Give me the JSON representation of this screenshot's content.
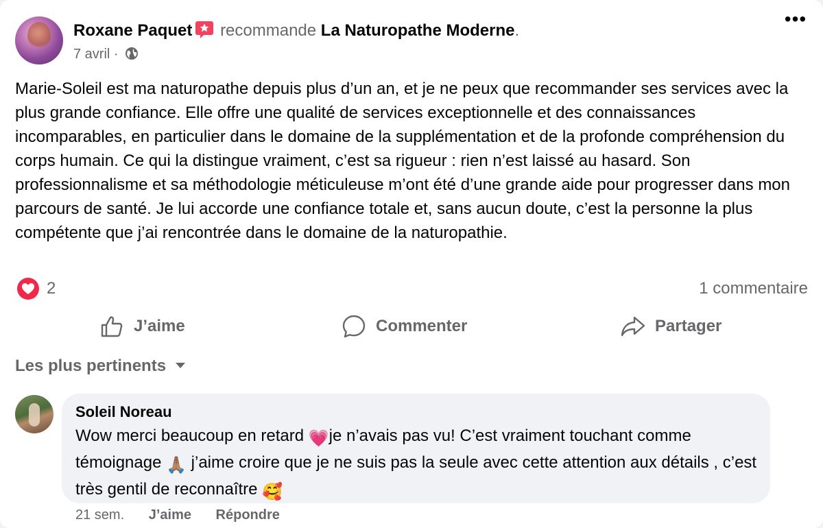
{
  "post": {
    "author": "Roxane Paquet",
    "recommends": "recommande",
    "page": "La Naturopathe Moderne",
    "period": ".",
    "date": "7 avril",
    "separator": "·",
    "more": "•••",
    "body": "Marie-Soleil est ma naturopathe  depuis plus d’un an, et je ne peux que recommander ses services avec la plus grande confiance. Elle offre une qualité de services exceptionnelle et des connaissances incomparables, en particulier dans le domaine de la supplémentation et de la profonde compréhension du corps humain. Ce qui la distingue vraiment, c’est sa rigueur : rien n’est laissé au hasard. Son professionnalisme et sa méthodologie méticuleuse m’ont été d’une grande aide pour progresser dans mon parcours de santé. Je lui accorde une confiance totale et, sans aucun doute, c’est la personne la plus compétente que j’ai rencontrée dans le domaine de la naturopathie."
  },
  "reactions": {
    "count": "2",
    "comments": "1 commentaire"
  },
  "actions": {
    "like": "J’aime",
    "comment": "Commenter",
    "share": "Partager"
  },
  "sort": {
    "label": "Les plus pertinents"
  },
  "comment": {
    "author": "Soleil Noreau",
    "text_1": "Wow merci beaucoup en retard ",
    "emoji_1": "💗",
    "text_2": "je n’avais pas vu! C’est vraiment touchant comme témoignage ",
    "emoji_2": "🙏🏽",
    "text_3": " j’aime croire que je ne suis pas la seule avec cette attention aux détails , c’est très gentil de reconnaître ",
    "emoji_3": "🥰",
    "time": "21 sem.",
    "like": "J’aime",
    "reply": "Répondre"
  },
  "colors": {
    "secondary_text": "#65676b",
    "heart_red": "#f0284a",
    "badge_pink": "#f3425f",
    "bubble_bg": "#f0f2f5"
  },
  "icons": [
    "recommend-badge-icon",
    "globe-icon",
    "more-options-icon",
    "love-reaction-icon",
    "like-thumb-icon",
    "comment-bubble-icon",
    "share-arrow-icon",
    "caret-down-icon"
  ]
}
